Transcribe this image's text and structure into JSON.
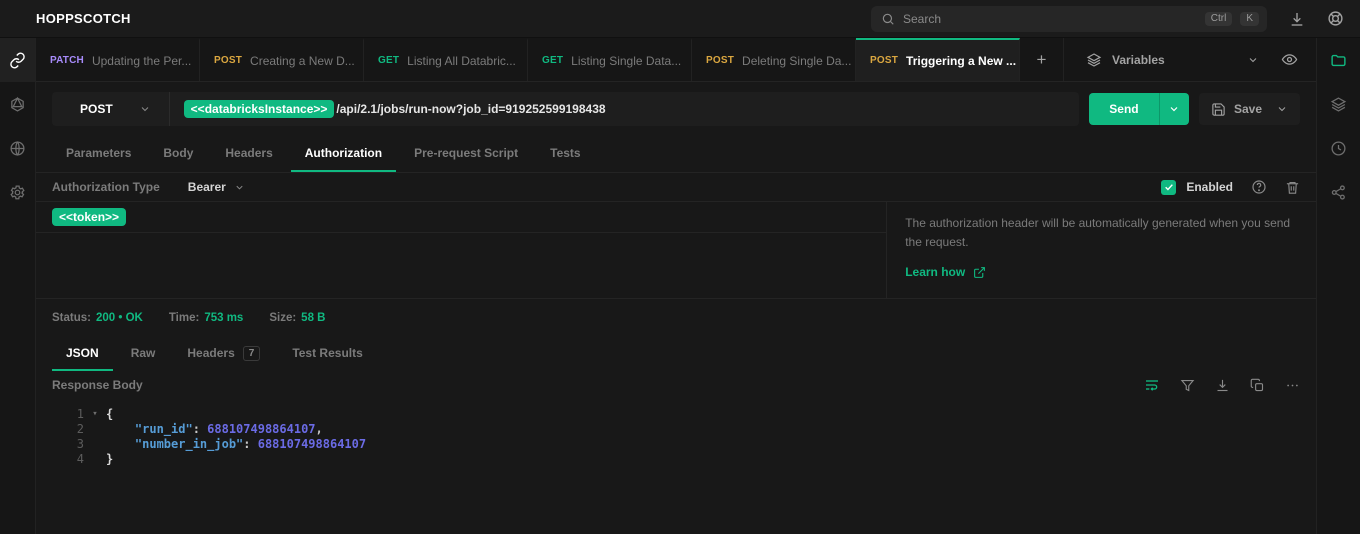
{
  "app": {
    "title": "HOPPSCOTCH"
  },
  "topbar": {
    "search_placeholder": "Search",
    "shortcut_ctrl": "Ctrl",
    "shortcut_k": "K"
  },
  "request_tabs": [
    {
      "method": "PATCH",
      "label": "Updating the Per..."
    },
    {
      "method": "POST",
      "label": "Creating a New D..."
    },
    {
      "method": "GET",
      "label": "Listing All Databric..."
    },
    {
      "method": "GET",
      "label": "Listing Single Data..."
    },
    {
      "method": "POST",
      "label": "Deleting Single Da..."
    },
    {
      "method": "POST",
      "label": "Triggering a New ..."
    }
  ],
  "add_tab_label": "+",
  "environment": {
    "label": "Variables"
  },
  "request": {
    "method": "POST",
    "url_variable": "<<databricksInstance>>",
    "url_rest": "/api/2.1/jobs/run-now?job_id=919252599198438",
    "send_label": "Send",
    "save_label": "Save",
    "tabs": {
      "parameters": "Parameters",
      "body": "Body",
      "headers": "Headers",
      "authorization": "Authorization",
      "prerequest": "Pre-request Script",
      "tests": "Tests"
    }
  },
  "authorization": {
    "type_label": "Authorization Type",
    "type_value": "Bearer",
    "enabled_label": "Enabled",
    "token": "<<token>>",
    "help_text": "The authorization header will be automatically generated when you send the request.",
    "learn_link": "Learn how"
  },
  "response": {
    "status_label": "Status:",
    "status_value": "200 • OK",
    "time_label": "Time:",
    "time_value": "753 ms",
    "size_label": "Size:",
    "size_value": "58 B",
    "tabs": {
      "json": "JSON",
      "raw": "Raw",
      "headers": "Headers",
      "headers_count": "7",
      "tests": "Test Results"
    },
    "body_label": "Response Body",
    "code": {
      "line_numbers": [
        "1",
        "2",
        "3",
        "4"
      ],
      "fold_marker": "▾",
      "open_brace": "{",
      "close_brace": "}",
      "indent": "    ",
      "key1": "\"run_id\"",
      "colon1": ": ",
      "value1": "688107498864107",
      "comma1": ",",
      "key2": "\"number_in_job\"",
      "colon2": ": ",
      "value2": "688107498864107"
    }
  },
  "colors": {
    "accent_green": "#10b981",
    "method_post": "#dba740",
    "method_get": "#10b981",
    "method_patch": "#a78bfa",
    "code_key_blue": "#569cd6",
    "code_number_purple": "#6b6be5"
  }
}
